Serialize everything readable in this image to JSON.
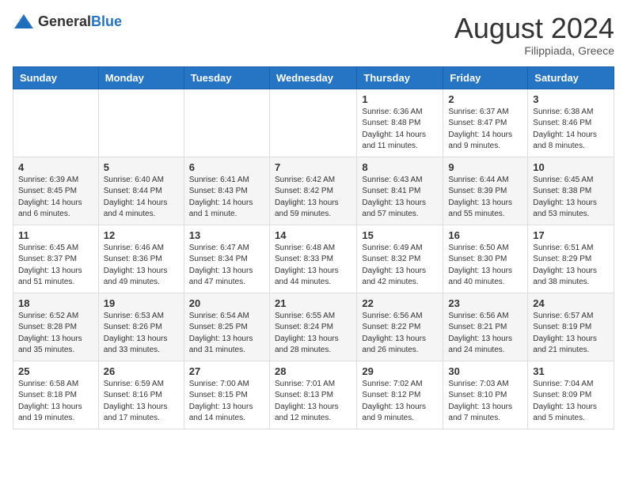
{
  "header": {
    "logo_general": "General",
    "logo_blue": "Blue",
    "month_year": "August 2024",
    "location": "Filippiada, Greece"
  },
  "weekdays": [
    "Sunday",
    "Monday",
    "Tuesday",
    "Wednesday",
    "Thursday",
    "Friday",
    "Saturday"
  ],
  "weeks": [
    [
      {
        "day": "",
        "info": ""
      },
      {
        "day": "",
        "info": ""
      },
      {
        "day": "",
        "info": ""
      },
      {
        "day": "",
        "info": ""
      },
      {
        "day": "1",
        "info": "Sunrise: 6:36 AM\nSunset: 8:48 PM\nDaylight: 14 hours and 11 minutes."
      },
      {
        "day": "2",
        "info": "Sunrise: 6:37 AM\nSunset: 8:47 PM\nDaylight: 14 hours and 9 minutes."
      },
      {
        "day": "3",
        "info": "Sunrise: 6:38 AM\nSunset: 8:46 PM\nDaylight: 14 hours and 8 minutes."
      }
    ],
    [
      {
        "day": "4",
        "info": "Sunrise: 6:39 AM\nSunset: 8:45 PM\nDaylight: 14 hours and 6 minutes."
      },
      {
        "day": "5",
        "info": "Sunrise: 6:40 AM\nSunset: 8:44 PM\nDaylight: 14 hours and 4 minutes."
      },
      {
        "day": "6",
        "info": "Sunrise: 6:41 AM\nSunset: 8:43 PM\nDaylight: 14 hours and 1 minute."
      },
      {
        "day": "7",
        "info": "Sunrise: 6:42 AM\nSunset: 8:42 PM\nDaylight: 13 hours and 59 minutes."
      },
      {
        "day": "8",
        "info": "Sunrise: 6:43 AM\nSunset: 8:41 PM\nDaylight: 13 hours and 57 minutes."
      },
      {
        "day": "9",
        "info": "Sunrise: 6:44 AM\nSunset: 8:39 PM\nDaylight: 13 hours and 55 minutes."
      },
      {
        "day": "10",
        "info": "Sunrise: 6:45 AM\nSunset: 8:38 PM\nDaylight: 13 hours and 53 minutes."
      }
    ],
    [
      {
        "day": "11",
        "info": "Sunrise: 6:45 AM\nSunset: 8:37 PM\nDaylight: 13 hours and 51 minutes."
      },
      {
        "day": "12",
        "info": "Sunrise: 6:46 AM\nSunset: 8:36 PM\nDaylight: 13 hours and 49 minutes."
      },
      {
        "day": "13",
        "info": "Sunrise: 6:47 AM\nSunset: 8:34 PM\nDaylight: 13 hours and 47 minutes."
      },
      {
        "day": "14",
        "info": "Sunrise: 6:48 AM\nSunset: 8:33 PM\nDaylight: 13 hours and 44 minutes."
      },
      {
        "day": "15",
        "info": "Sunrise: 6:49 AM\nSunset: 8:32 PM\nDaylight: 13 hours and 42 minutes."
      },
      {
        "day": "16",
        "info": "Sunrise: 6:50 AM\nSunset: 8:30 PM\nDaylight: 13 hours and 40 minutes."
      },
      {
        "day": "17",
        "info": "Sunrise: 6:51 AM\nSunset: 8:29 PM\nDaylight: 13 hours and 38 minutes."
      }
    ],
    [
      {
        "day": "18",
        "info": "Sunrise: 6:52 AM\nSunset: 8:28 PM\nDaylight: 13 hours and 35 minutes."
      },
      {
        "day": "19",
        "info": "Sunrise: 6:53 AM\nSunset: 8:26 PM\nDaylight: 13 hours and 33 minutes."
      },
      {
        "day": "20",
        "info": "Sunrise: 6:54 AM\nSunset: 8:25 PM\nDaylight: 13 hours and 31 minutes."
      },
      {
        "day": "21",
        "info": "Sunrise: 6:55 AM\nSunset: 8:24 PM\nDaylight: 13 hours and 28 minutes."
      },
      {
        "day": "22",
        "info": "Sunrise: 6:56 AM\nSunset: 8:22 PM\nDaylight: 13 hours and 26 minutes."
      },
      {
        "day": "23",
        "info": "Sunrise: 6:56 AM\nSunset: 8:21 PM\nDaylight: 13 hours and 24 minutes."
      },
      {
        "day": "24",
        "info": "Sunrise: 6:57 AM\nSunset: 8:19 PM\nDaylight: 13 hours and 21 minutes."
      }
    ],
    [
      {
        "day": "25",
        "info": "Sunrise: 6:58 AM\nSunset: 8:18 PM\nDaylight: 13 hours and 19 minutes."
      },
      {
        "day": "26",
        "info": "Sunrise: 6:59 AM\nSunset: 8:16 PM\nDaylight: 13 hours and 17 minutes."
      },
      {
        "day": "27",
        "info": "Sunrise: 7:00 AM\nSunset: 8:15 PM\nDaylight: 13 hours and 14 minutes."
      },
      {
        "day": "28",
        "info": "Sunrise: 7:01 AM\nSunset: 8:13 PM\nDaylight: 13 hours and 12 minutes."
      },
      {
        "day": "29",
        "info": "Sunrise: 7:02 AM\nSunset: 8:12 PM\nDaylight: 13 hours and 9 minutes."
      },
      {
        "day": "30",
        "info": "Sunrise: 7:03 AM\nSunset: 8:10 PM\nDaylight: 13 hours and 7 minutes."
      },
      {
        "day": "31",
        "info": "Sunrise: 7:04 AM\nSunset: 8:09 PM\nDaylight: 13 hours and 5 minutes."
      }
    ]
  ]
}
